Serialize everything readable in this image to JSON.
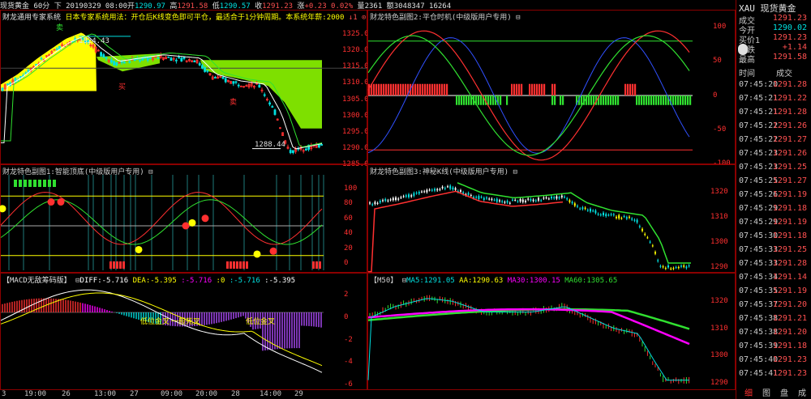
{
  "header": {
    "symbol": "现货黄金",
    "period": "60分",
    "mark": "下",
    "date": "20190329 08:00",
    "open_label": "开",
    "open": "1290.97",
    "high_label": "高",
    "high": "1291.58",
    "low_label": "低",
    "low": "1290.57",
    "close_label": "收",
    "close": "1291.23",
    "change_label": "涨",
    "change": "+0.23 0.02%",
    "vol_label": "量",
    "vol": "2361",
    "oi_label": "额",
    "oi": "3048347 16264"
  },
  "panels": {
    "main": {
      "title": "财龙通用专家系统",
      "desc": "日本专家系统用法：开仓后K线变色即可平仓，最适合于1分钟周期。本系统年薪:2000",
      "tag": "↓1 ⊙",
      "label_high": "1324.43",
      "label_low": "1288.44",
      "marks": [
        "卖",
        "买",
        "卖"
      ],
      "axis": [
        "1325.0",
        "1320.0",
        "1315.0",
        "1310.0",
        "1305.0",
        "1300.0",
        "1295.0",
        "1290.0",
        "1285.0"
      ]
    },
    "sub1": {
      "title": "财龙特色副图1:智能顶底(中级版用户专用)",
      "tag": "⊟",
      "axis": [
        "100",
        "80",
        "60",
        "40",
        "20",
        "0"
      ]
    },
    "macd": {
      "title": "【MACD无敌筹码版】",
      "tag": "⊟",
      "diff_label": "DIFF:",
      "diff": "-5.716",
      "dea_label": "DEA:",
      "dea": "-5.395",
      "v3": ":-5.716",
      "v4": ":0",
      "v5": ":-5.716",
      "v6": ":-5.395",
      "labels": [
        "低位金叉",
        "一般死叉",
        "低位金叉"
      ],
      "axis": [
        "2",
        "0",
        "-2",
        "-4",
        "-6"
      ]
    },
    "sub2": {
      "title": "财龙特色副图2:平仓时机(中级版用户专用)",
      "tag": "⊟",
      "axis": [
        "100",
        "50",
        "0",
        "-50",
        "-100"
      ]
    },
    "sub3": {
      "title": "财龙特色副图3:神秘K线(中级版用户专用)",
      "tag": "⊟",
      "axis": [
        "1320",
        "1310",
        "1300",
        "1290"
      ]
    },
    "m50": {
      "title": "【M50】",
      "tag": "⊟",
      "ma5_label": "MA5:",
      "ma5": "1291.05",
      "aa_label": "AA:",
      "aa": "1290.63",
      "ma30_label": "MA30:",
      "ma30": "1300.15",
      "ma60_label": "MA60:",
      "ma60": "1305.65",
      "axis": [
        "1320",
        "1310",
        "1300",
        "1290"
      ]
    }
  },
  "time_axis": [
    "19:00",
    "26",
    "13:00",
    "27",
    "09:00",
    "20:00",
    "28",
    "14:00",
    "29"
  ],
  "time_axis_left": "3",
  "side": {
    "symbol": "XAU",
    "name": "现货黄金",
    "quotes": [
      {
        "k": "成交",
        "v": "1291.23",
        "c": "#ff5050"
      },
      {
        "k": "今开",
        "v": "1290.02",
        "c": "#00e0e0"
      },
      {
        "k": "买价1",
        "v": "1291.23",
        "c": "#ff5050"
      },
      {
        "k": "涨跌",
        "v": "+1.14",
        "c": "#ff5050"
      },
      {
        "k": "最高",
        "v": "1291.58",
        "c": "#ff5050"
      }
    ],
    "col_time": "时间",
    "col_deal": "成交",
    "ticks": [
      {
        "t": "07:45:20",
        "p": "1291.28"
      },
      {
        "t": "07:45:21",
        "p": "1291.22"
      },
      {
        "t": "07:45:21",
        "p": "1291.28"
      },
      {
        "t": "07:45:22",
        "p": "1291.26"
      },
      {
        "t": "07:45:22",
        "p": "1291.27"
      },
      {
        "t": "07:45:23",
        "p": "1291.26"
      },
      {
        "t": "07:45:23",
        "p": "1291.25"
      },
      {
        "t": "07:45:25",
        "p": "1291.27"
      },
      {
        "t": "07:45:26",
        "p": "1291.19"
      },
      {
        "t": "07:45:29",
        "p": "1291.18"
      },
      {
        "t": "07:45:29",
        "p": "1291.19"
      },
      {
        "t": "07:45:30",
        "p": "1291.18"
      },
      {
        "t": "07:45:33",
        "p": "1291.25"
      },
      {
        "t": "07:45:33",
        "p": "1291.28"
      },
      {
        "t": "07:45:34",
        "p": "1291.14"
      },
      {
        "t": "07:45:35",
        "p": "1291.19"
      },
      {
        "t": "07:45:37",
        "p": "1291.20"
      },
      {
        "t": "07:45:38",
        "p": "1291.21"
      },
      {
        "t": "07:45:38",
        "p": "1291.20"
      },
      {
        "t": "07:45:39",
        "p": "1291.18"
      },
      {
        "t": "07:45:40",
        "p": "1291.23"
      },
      {
        "t": "07:45:41",
        "p": "1291.23"
      }
    ],
    "tabs": [
      "细",
      "图",
      "盘",
      "成"
    ]
  },
  "colors": {
    "up": "#ff3030",
    "down": "#00e0e0",
    "green": "#30e030",
    "yellow": "#ffff00",
    "magenta": "#ff00ff",
    "border": "#8b0000"
  }
}
